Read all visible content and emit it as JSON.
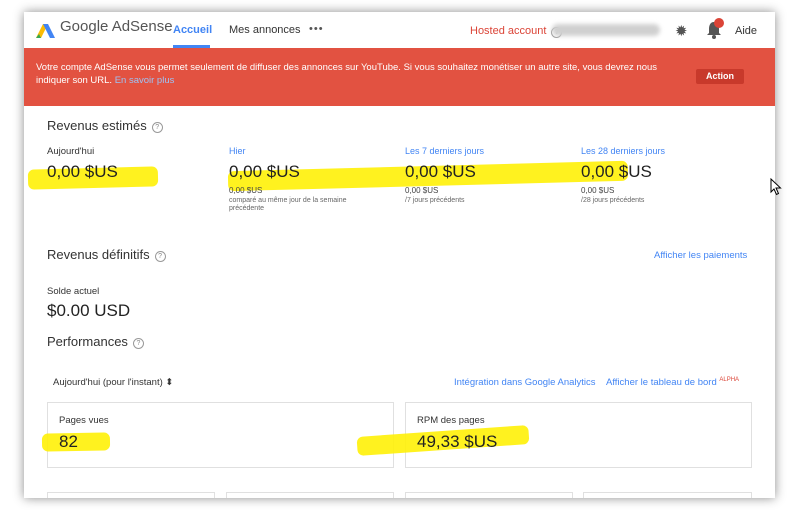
{
  "header": {
    "brand": "Google AdSense",
    "tabs": [
      {
        "label": "Accueil",
        "active": true
      },
      {
        "label": "Mes annonces"
      }
    ],
    "more_label": "•••",
    "hosted_account": "Hosted account",
    "help_glyph": "?",
    "help_label": "Aide"
  },
  "alert": {
    "message": "Votre compte AdSense vous permet seulement de diffuser des annonces sur YouTube. Si vous souhaitez monétiser un autre site, vous devrez nous indiquer son URL.",
    "link": "En savoir plus",
    "action": "Action"
  },
  "estimated": {
    "title": "Revenus estimés",
    "periods": [
      {
        "label": "Aujourd'hui",
        "value": "0,00 $US"
      },
      {
        "label": "Hier",
        "value": "0,00 $US",
        "sub_value": "0,00 $US",
        "sub_label": "comparé au même jour de la semaine précédente"
      },
      {
        "label": "Les 7 derniers jours",
        "value": "0,00 $US",
        "sub_value": "0,00 $US",
        "sub_label": "/7 jours précédents"
      },
      {
        "label": "Les 28 derniers jours",
        "value": "0,00 $US",
        "sub_value": "0,00 $US",
        "sub_label": "/28 jours précédents"
      }
    ]
  },
  "final": {
    "title": "Revenus définitifs",
    "payments_link": "Afficher les paiements",
    "balance_label": "Solde actuel",
    "balance_value": "$0.00 USD"
  },
  "performance": {
    "title": "Performances",
    "range_selector": "Aujourd'hui (pour l'instant) ⬍",
    "analytics_link": "Intégration dans Google Analytics",
    "dashboard_link": "Afficher le tableau de bord",
    "alpha_badge": "ALPHA",
    "cards": [
      {
        "label": "Pages vues",
        "value": "82"
      },
      {
        "label": "RPM des pages",
        "value": "49,33 $US"
      }
    ]
  },
  "colors": {
    "accent": "#4285f4",
    "alert_bg": "#e25241",
    "highlight": "#fff000"
  }
}
